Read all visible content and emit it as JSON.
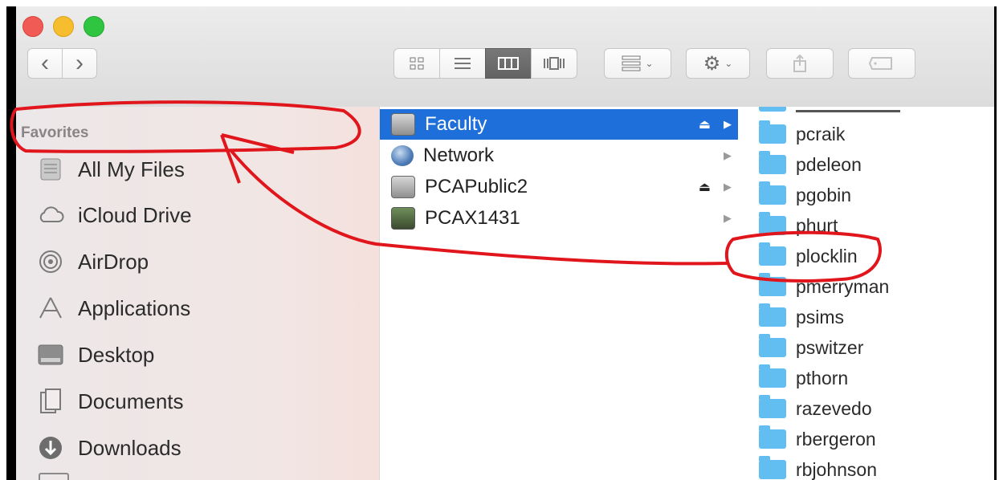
{
  "toolbar": {
    "back_icon": "‹",
    "forward_icon": "›",
    "view_icons": [
      "icon-view-icon",
      "list-view-icon",
      "column-view-icon",
      "cover-flow-view-icon"
    ],
    "arrange_icon": "arrange-icon",
    "action_icon": "gear-icon",
    "share_icon": "share-icon",
    "tag_icon": "tag-icon"
  },
  "sidebar": {
    "heading": "Favorites",
    "items": [
      {
        "label": "All My Files",
        "icon": "all-files-icon"
      },
      {
        "label": "iCloud Drive",
        "icon": "cloud-icon"
      },
      {
        "label": "AirDrop",
        "icon": "airdrop-icon"
      },
      {
        "label": "Applications",
        "icon": "applications-icon"
      },
      {
        "label": "Desktop",
        "icon": "desktop-icon"
      },
      {
        "label": "Documents",
        "icon": "documents-icon"
      },
      {
        "label": "Downloads",
        "icon": "downloads-icon"
      }
    ]
  },
  "volumes": [
    {
      "label": "Faculty",
      "selected": true,
      "eject": true
    },
    {
      "label": "Network",
      "selected": false,
      "eject": false
    },
    {
      "label": "PCAPublic2",
      "selected": false,
      "eject": true
    },
    {
      "label": "PCAX1431",
      "selected": false,
      "eject": false
    }
  ],
  "folders": [
    "pcraik",
    "pdeleon",
    "pgobin",
    "phurt",
    "plocklin",
    "pmerryman",
    "psims",
    "pswitzer",
    "pthorn",
    "razevedo",
    "rbergeron",
    "rbjohnson"
  ],
  "colors": {
    "selection": "#1e6fd9",
    "folder": "#62bdf0",
    "annotation": "#e0161c",
    "close": "#f15b55",
    "minimize": "#f6bd2e",
    "zoom": "#30c541"
  }
}
